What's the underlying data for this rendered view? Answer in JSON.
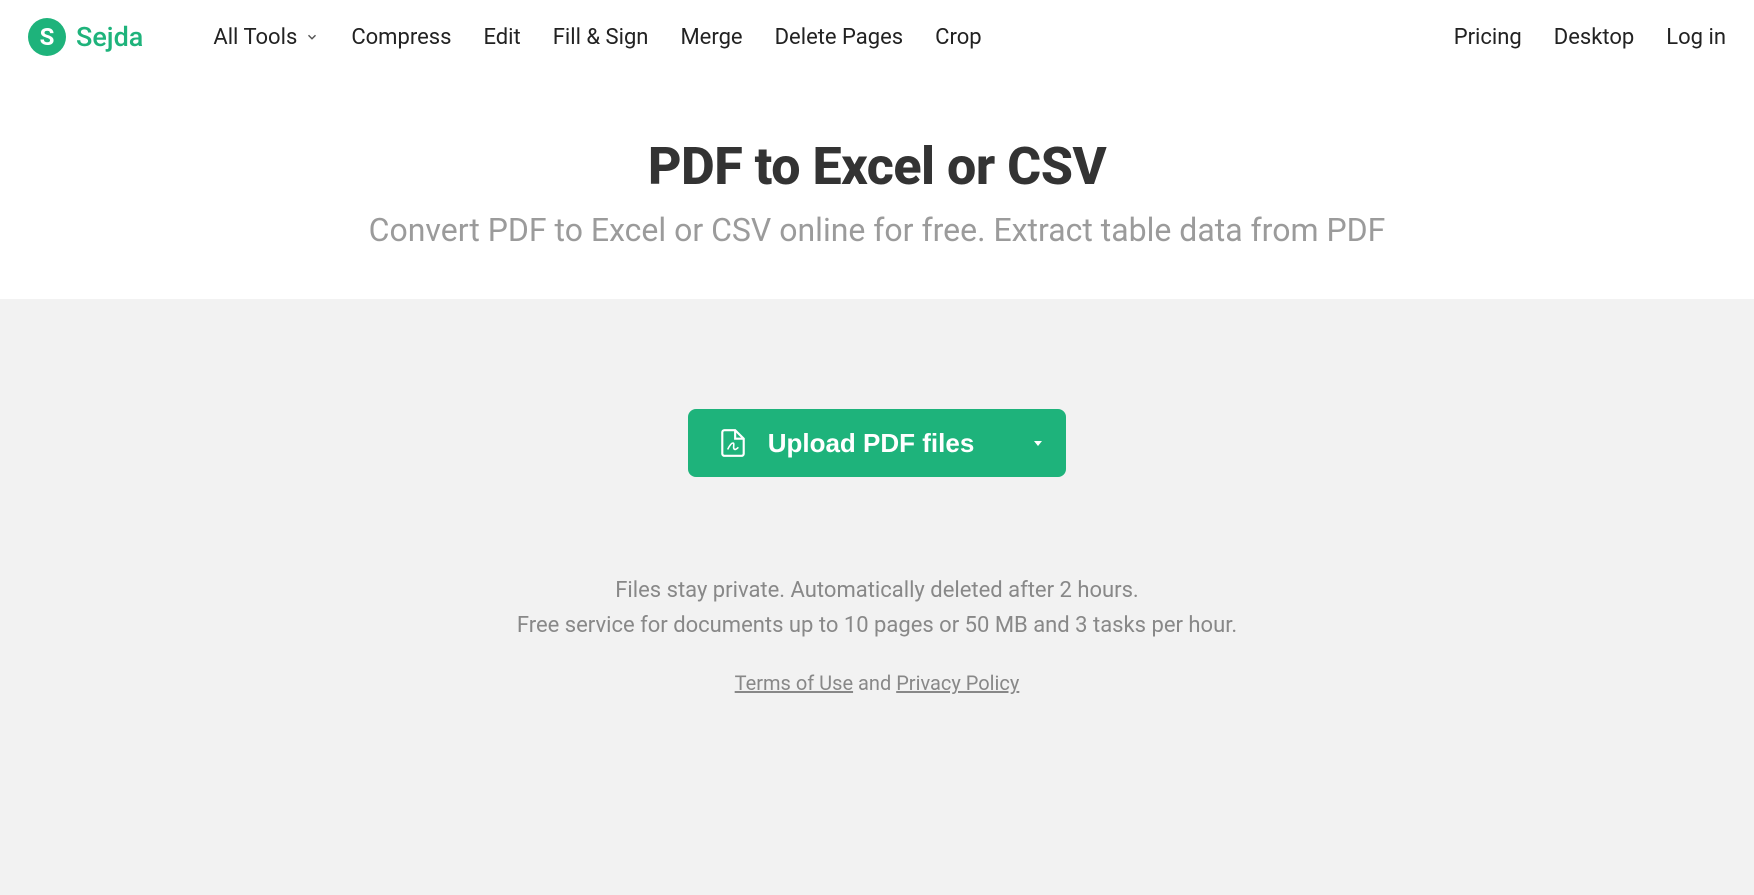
{
  "brand": {
    "name": "Sejda",
    "initial": "S"
  },
  "nav": {
    "left": {
      "all_tools": "All Tools",
      "compress": "Compress",
      "edit": "Edit",
      "fill_sign": "Fill & Sign",
      "merge": "Merge",
      "delete_pages": "Delete Pages",
      "crop": "Crop"
    },
    "right": {
      "pricing": "Pricing",
      "desktop": "Desktop",
      "login": "Log in"
    }
  },
  "hero": {
    "title": "PDF to Excel or CSV",
    "subtitle": "Convert PDF to Excel or CSV online for free. Extract table data from PDF"
  },
  "upload": {
    "label": "Upload PDF files"
  },
  "info": {
    "line1": "Files stay private. Automatically deleted after 2 hours.",
    "line2": "Free service for documents up to 10 pages or 50 MB and 3 tasks per hour."
  },
  "legal": {
    "terms": "Terms of Use",
    "and": " and ",
    "privacy": "Privacy Policy"
  },
  "colors": {
    "accent": "#1eb37b",
    "gray_bg": "#f2f2f2",
    "muted": "#9b9b9b"
  }
}
